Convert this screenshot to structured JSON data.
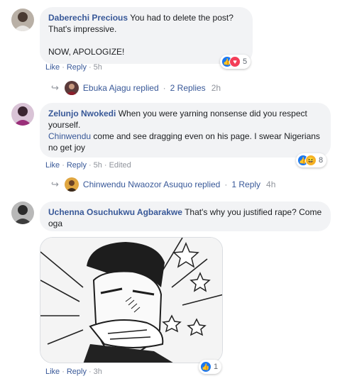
{
  "comments": [
    {
      "author": "Daberechi Precious",
      "text": "You had to delete the post? That's impressive.",
      "text2": "NOW, APOLOGIZE!",
      "like": "Like",
      "reply": "Reply",
      "time": "5h",
      "reactions": {
        "icons": [
          "like-icon",
          "love-icon"
        ],
        "count": "5"
      },
      "replies": {
        "author": "Ebuka Ajagu replied",
        "count": "2 Replies",
        "time": "2h"
      }
    },
    {
      "author": "Zelunjo Nwokedi",
      "text": "When you were yarning nonsense did you respect yourself.",
      "mention": "Chinwendu",
      "text2": "come and see dragging even on his page. I swear Nigerians no get joy",
      "like": "Like",
      "reply": "Reply",
      "time": "5h",
      "edited": "Edited",
      "reactions": {
        "icons": [
          "like-icon",
          "haha-icon"
        ],
        "count": "8"
      },
      "replies": {
        "author": "Chinwendu Nwaozor Asuquo replied",
        "count": "1 Reply",
        "time": "4h"
      }
    },
    {
      "author": "Uchenna Osuchukwu Agbarakwe",
      "text": "That's why you justified rape? Come oga",
      "like": "Like",
      "reply": "Reply",
      "time": "3h",
      "reactions": {
        "icons": [
          "like-icon"
        ],
        "count": "1"
      }
    }
  ],
  "colors": {
    "link": "#385898",
    "bubble": "#f2f3f5",
    "like": "#1877f2",
    "love": "#f33e58",
    "haha": "#f7b125"
  }
}
